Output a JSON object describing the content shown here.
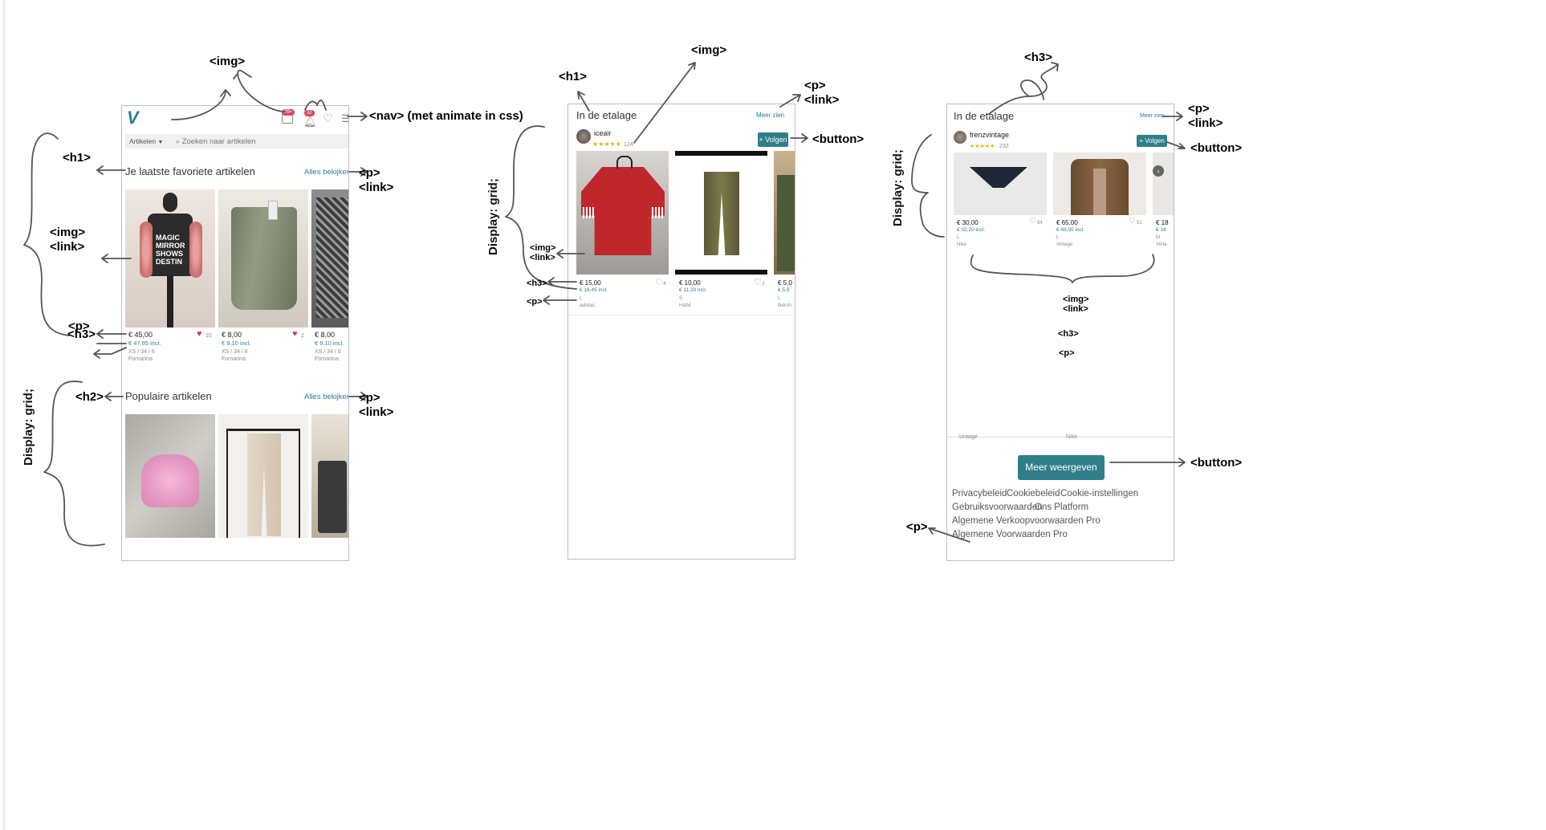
{
  "annotations": {
    "img_top": "<img>",
    "nav": "<nav> (met animate in css)",
    "h1_a": "<h1>",
    "p_link_a": "<p>\n<link>",
    "img_link_a": "<img>\n<link>",
    "p_a": "<p>",
    "h3_a": "<h3>",
    "h2_a": "<h2>",
    "p_link_b": "<p>\n<link>",
    "grid_a": "Display: grid;",
    "h1_b": "<h1>",
    "img_b": "<img>",
    "p_link_c": "<p>\n<link>",
    "button_b": "<button>",
    "grid_b": "Display: grid;",
    "img_link_b": "<img>\n<link>",
    "h3_b": "<h3>",
    "p_b": "<p>",
    "h3_c": "<h3>",
    "p_link_d": "<p>\n<link>",
    "button_c": "<button>",
    "grid_c": "Display: grid;",
    "img_link_c": "<img>\n<link>",
    "h3_c2": "<h3>",
    "p_c2": "<p>",
    "button_c2": "<button>",
    "p_c3": "<p>"
  },
  "screen1": {
    "logo": "V",
    "badge_msgs": "99+",
    "badge_bell": "32",
    "dropdown": "Artikelen",
    "search_placeholder": "Zoeken naar artikelen",
    "fav_title": "Je laatste favoriete artikelen",
    "see_all": "Alles bekijken",
    "items": [
      {
        "price": "€ 45,00",
        "incl": "€ 47,95 incl.",
        "size": "XS / 34 / 6",
        "brand": "Fornarina",
        "likes": "10",
        "img_text": "MAGIC\nMIRROR\nSHOWS\nDESTIN"
      },
      {
        "price": "€ 8,00",
        "incl": "€ 9,10 incl.",
        "size": "XS / 34 / 6",
        "brand": "Fornarina",
        "likes": "2"
      },
      {
        "price": "€ 8,00",
        "incl": "€ 9,10 incl.",
        "size": "XS / 34 / 6",
        "brand": "Fornarina"
      }
    ],
    "popular_title": "Populaire artikelen",
    "see_all_2": "Alles bekijken"
  },
  "screen2": {
    "title": "In de etalage",
    "see_more": "Meer zien",
    "user": "iceair",
    "stars": "★★★★★",
    "reviews": "124",
    "follow": "+ Volgen",
    "items": [
      {
        "price": "€ 15,00",
        "incl": "€ 16,45 incl.",
        "size": "L",
        "brand": "adidas",
        "likes": "4"
      },
      {
        "price": "€ 10,00",
        "incl": "€ 11,20 incl.",
        "size": "S",
        "brand": "H&M",
        "likes": "2"
      },
      {
        "price": "€ 5,0",
        "incl": "€ 5,9",
        "size": "L",
        "brand": "Bersh"
      }
    ]
  },
  "screen3": {
    "title": "In de etalage",
    "see_more": "Meer zien",
    "user": "frenzvintage",
    "stars": "★★★★★",
    "reviews": "232",
    "follow": "+ Volgen",
    "items": [
      {
        "price": "€ 30,00",
        "incl": "€ 32,20 incl.",
        "size": "L",
        "brand": "Nike",
        "likes": "94"
      },
      {
        "price": "€ 65,00",
        "incl": "€ 68,95 incl.",
        "size": "L",
        "brand": "Vintage",
        "likes": "51"
      },
      {
        "price": "€ 18",
        "incl": "€ 18",
        "size": "M",
        "brand": "Vinta"
      }
    ],
    "cut_texts": [
      "Vintage",
      "Nike"
    ],
    "more_button": "Meer weergeven",
    "footer": [
      "Privacybeleid",
      "Cookiebeleid",
      "Cookie-instellingen",
      "Gebruiksvoorwaarden",
      "Ons Platform",
      "Algemene Verkoopvoorwaarden Pro",
      "Algemene Voorwaarden Pro"
    ]
  },
  "colors": {
    "accent": "#2f7f89",
    "badge": "#d9465a",
    "heart": "#d33a4a",
    "star": "#f0b400"
  }
}
